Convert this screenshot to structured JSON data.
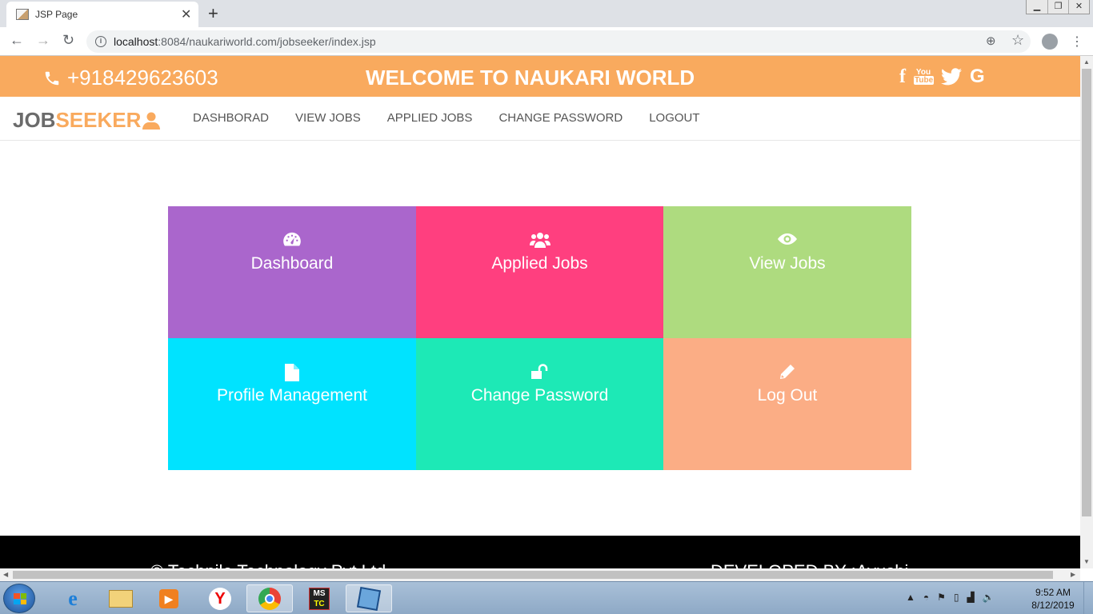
{
  "browser": {
    "tab_title": "JSP Page",
    "tab_close": "✕",
    "new_tab": "+",
    "url_host": "localhost",
    "url_rest": ":8084/naukariworld.com/jobseeker/index.jsp"
  },
  "header": {
    "phone": "+918429623603",
    "welcome": "WELCOME TO NAUKARI WORLD",
    "social": [
      "f",
      "You Tube",
      "twitter",
      "G"
    ]
  },
  "navbar": {
    "brand_job": "JOB",
    "brand_seeker": "SEEKER",
    "links": [
      "DASHBORAD",
      "VIEW JOBS",
      "APPLIED JOBS",
      "CHANGE PASSWORD",
      "LOGOUT"
    ]
  },
  "tiles": [
    {
      "label": "Dashboard",
      "icon": "dashboard-icon",
      "color": "#aa66cc"
    },
    {
      "label": "Applied Jobs",
      "icon": "users-icon",
      "color": "#ff3f7f"
    },
    {
      "label": "View Jobs",
      "icon": "eye-icon",
      "color": "#aedb7f"
    },
    {
      "label": "Profile Management",
      "icon": "file-icon",
      "color": "#00e3ff"
    },
    {
      "label": "Change Password",
      "icon": "unlock-icon",
      "color": "#1de9b6"
    },
    {
      "label": "Log Out",
      "icon": "pencil-icon",
      "color": "#fbad85"
    }
  ],
  "footer": {
    "copyright": "© Technile Technology Pvt Ltd",
    "developer": "DEVELOPED BY :Ayushi"
  },
  "taskbar": {
    "time": "9:52 AM",
    "date": "8/12/2019"
  }
}
